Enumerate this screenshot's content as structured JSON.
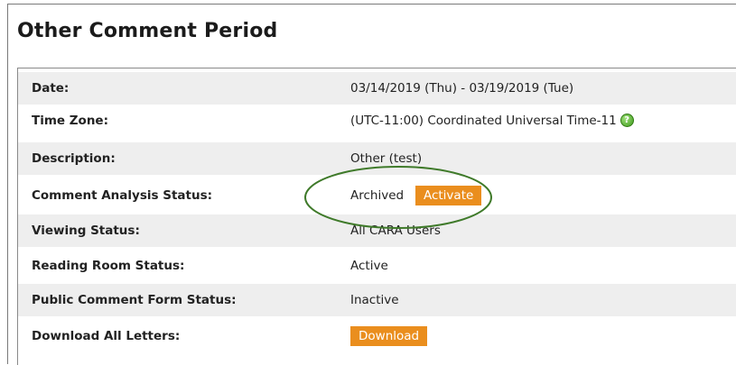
{
  "title": "Other Comment Period",
  "rows": [
    {
      "label": "Date:",
      "value": "03/14/2019 (Thu) - 03/19/2019 (Tue)"
    },
    {
      "label": "Time Zone:",
      "value": "(UTC-11:00) Coordinated Universal Time-11"
    },
    {
      "label": "Description:",
      "value": "Other (test)"
    },
    {
      "label": "Comment Analysis Status:",
      "value": "Archived",
      "button": "Activate"
    },
    {
      "label": "Viewing Status:",
      "value": "All CARA Users"
    },
    {
      "label": "Reading Room Status:",
      "value": "Active"
    },
    {
      "label": "Public Comment Form Status:",
      "value": "Inactive"
    },
    {
      "label": "Download All Letters:",
      "button": "Download"
    }
  ],
  "colors": {
    "button": "#ea8e1e",
    "annotation_ellipse": "#3f7a2a",
    "row_shade": "#eeeeee"
  },
  "icons": {
    "time_zone_help": "help-icon"
  }
}
